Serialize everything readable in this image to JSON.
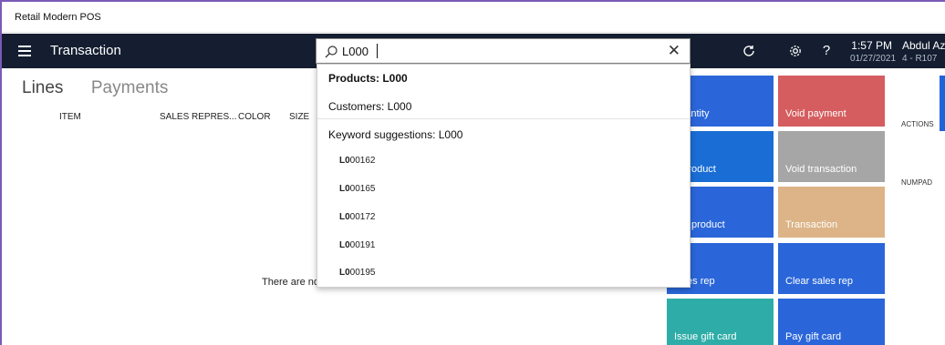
{
  "app": {
    "window_title": "Retail Modern POS"
  },
  "nav": {
    "title": "Transaction",
    "time": "1:57 PM",
    "date": "01/27/2021",
    "user_name": "Abdul Aziz",
    "user_register": "4 - R107"
  },
  "search": {
    "value": "L000",
    "placeholder": ""
  },
  "tabs": {
    "lines": "Lines",
    "payments": "Payments"
  },
  "table": {
    "columns": [
      "ITEM",
      "SALES REPRES...",
      "COLOR",
      "SIZE"
    ],
    "empty_message": "There are no p"
  },
  "dropdown": {
    "products": "Products: L000",
    "customers": "Customers: L000",
    "keyword_header": "Keyword suggestions: L000",
    "items": [
      {
        "prefix": "L0",
        "rest": "00162"
      },
      {
        "prefix": "L0",
        "rest": "00165"
      },
      {
        "prefix": "L0",
        "rest": "00172"
      },
      {
        "prefix": "L0",
        "rest": "00191"
      },
      {
        "prefix": "L0",
        "rest": "00195"
      }
    ]
  },
  "tiles": [
    {
      "label": "quantity",
      "color": "#2a66d9"
    },
    {
      "label": "Void payment",
      "color": "#d55d5f"
    },
    {
      "label": "d product",
      "color": "#1a6dd4"
    },
    {
      "label": "Void transaction",
      "color": "#a6a6a6"
    },
    {
      "label": "urn product",
      "color": "#2a66d9"
    },
    {
      "label": "Transaction",
      "color": "#dcb487"
    },
    {
      "label": "sales rep",
      "color": "#2a66d9"
    },
    {
      "label": "Clear sales rep",
      "color": "#2a66d9"
    },
    {
      "label": "Issue gift card",
      "color": "#2eada8"
    },
    {
      "label": "Pay gift card",
      "color": "#2a66d9"
    }
  ],
  "side_panel": {
    "actions": "ACTIONS",
    "numpad": "NUMPAD"
  },
  "icons": {
    "menu": "hamburger-icon",
    "search": "search-icon",
    "close": "close-icon",
    "refresh": "refresh-icon",
    "settings": "gear-icon",
    "help": "help-icon"
  },
  "colors": {
    "navbar": "#141e30",
    "accent": "#1f63d8",
    "window_border": "#7a5ab8"
  }
}
